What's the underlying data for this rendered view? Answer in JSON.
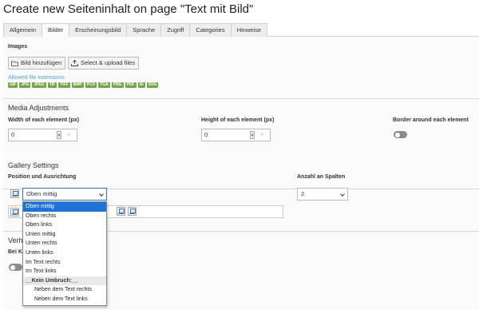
{
  "page": {
    "title": "Create new Seiteninhalt on page \"Text mit Bild\""
  },
  "tabs": [
    {
      "label": "Allgemein"
    },
    {
      "label": "Bilder"
    },
    {
      "label": "Erscheinungsbild"
    },
    {
      "label": "Sprache"
    },
    {
      "label": "Zugriff"
    },
    {
      "label": "Categories"
    },
    {
      "label": "Hinweise"
    }
  ],
  "active_tab": "Bilder",
  "images": {
    "label": "Images",
    "add_button": "Bild hinzufügen",
    "upload_button": "Select & upload files",
    "allowed_label": "Allowed file extensions",
    "extensions": [
      "GIF",
      "JPG",
      "JPEG",
      "TIF",
      "TIFF",
      "BMP",
      "PCX",
      "TGA",
      "PNG",
      "PDF",
      "AI",
      "SVG"
    ]
  },
  "media": {
    "heading": "Media Adjustments",
    "width_label": "Width of each element (px)",
    "width_value": "0",
    "height_label": "Height of each element (px)",
    "height_value": "0",
    "border_label": "Border around each element",
    "border_on": false
  },
  "gallery": {
    "heading": "Gallery Settings",
    "position_label": "Position und Ausrichtung",
    "position_value": "Oben mittig",
    "columns_label": "Anzahl an Spalten",
    "columns_value": "2"
  },
  "behind": {
    "heading_partial": "Verh",
    "label_partial": "Bei K"
  },
  "dropdown": {
    "options": [
      {
        "label": "Oben mittig",
        "kind": "selected"
      },
      {
        "label": "Oben rechts",
        "kind": "normal"
      },
      {
        "label": "Oben links",
        "kind": "normal"
      },
      {
        "label": "Unten mittig",
        "kind": "normal"
      },
      {
        "label": "Unten rechts",
        "kind": "normal"
      },
      {
        "label": "Unten links",
        "kind": "normal"
      },
      {
        "label": "Im Text rechts",
        "kind": "normal"
      },
      {
        "label": "Im Text links",
        "kind": "normal"
      },
      {
        "label": "__Kein Umbruch:__",
        "kind": "group"
      },
      {
        "label": "Neben dem Text rechts",
        "kind": "indent"
      },
      {
        "label": "Neben dem Text links",
        "kind": "indent"
      }
    ]
  }
}
